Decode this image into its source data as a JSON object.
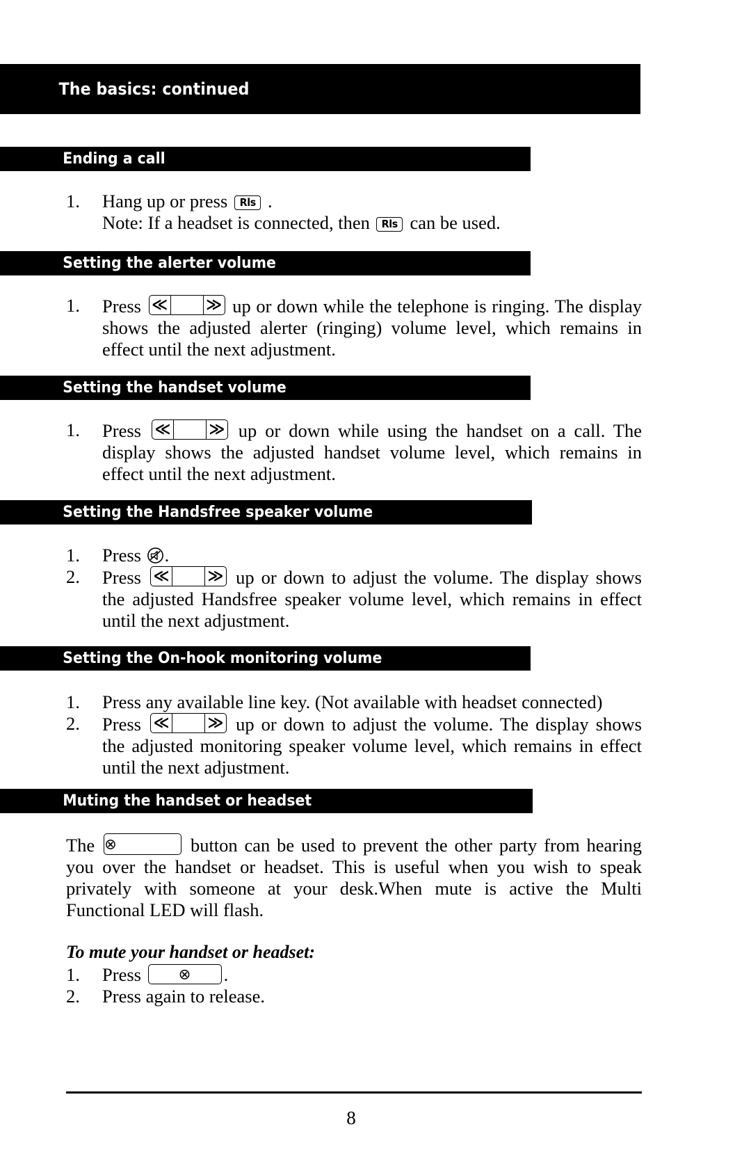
{
  "document": {
    "chapter_header": "The basics: continued",
    "page_number": "8"
  },
  "icons": {
    "rls_key_label": "Rls",
    "volume_key_left": "≪",
    "volume_key_right": "≫",
    "mute_key_glyph": "⊗",
    "handsfree_icon_name": "handsfree-speaker-icon"
  },
  "sections": [
    {
      "id": "ending-a-call",
      "title": "Ending a call",
      "items": [
        {
          "number": "1.",
          "text_before": "Hang up or press ",
          "key": "Rls",
          "text_after": " .",
          "note_before": "Note: If a headset is connected, then ",
          "note_key": "Rls",
          "note_after": " can be used."
        }
      ]
    },
    {
      "id": "setting-the-alerter-volume",
      "title": "Setting the alerter volume",
      "items": [
        {
          "number": "1.",
          "text_before": "Press ",
          "key": "volume",
          "text_after": " up or down while the telephone is ringing. The display shows the adjusted alerter (ringing) volume level, which remains in effect until the next adjustment."
        }
      ]
    },
    {
      "id": "setting-the-handset-volume",
      "title": "Setting the handset volume",
      "items": [
        {
          "number": "1.",
          "text_before": "Press ",
          "key": "volume",
          "text_after": " up or down while using the handset on a call. The display shows the adjusted handset volume level, which remains in effect until the next adjustment."
        }
      ]
    },
    {
      "id": "setting-the-handsfree-speaker-volume",
      "title": "Setting the Handsfree speaker volume",
      "items": [
        {
          "number": "1.",
          "text_before": "Press ",
          "key": "handsfree",
          "text_after": "."
        },
        {
          "number": "2.",
          "text_before": "Press ",
          "key": "volume",
          "text_after": " up or down to adjust the volume. The display shows the adjusted Handsfree speaker volume level, which remains in effect until the next adjustment."
        }
      ]
    },
    {
      "id": "setting-the-on-hook-monitoring-volume",
      "title": "Setting the On-hook monitoring volume",
      "items": [
        {
          "number": "1.",
          "text_plain": "Press any available line key. (Not available with headset connected)"
        },
        {
          "number": "2.",
          "text_before": "Press ",
          "key": "volume",
          "text_after": " up or down to adjust the volume. The display shows the adjusted monitoring speaker volume level, which remains in effect until the next adjustment."
        }
      ]
    },
    {
      "id": "muting-the-handset-or-headset",
      "title": "Muting the handset or headset",
      "paragraph": {
        "text_before": "The ",
        "key": "mute",
        "text_after": " button can be used to prevent the other party from hearing you over the handset or headset. This is useful when you wish to speak privately with someone at your desk.When mute is active the Multi Functional LED will flash."
      },
      "lead_in": "To mute your handset or headset:",
      "items": [
        {
          "number": "1.",
          "text_before": "Press ",
          "key": "mute",
          "text_after": "."
        },
        {
          "number": "2.",
          "text_plain": "Press again to release."
        }
      ]
    }
  ]
}
